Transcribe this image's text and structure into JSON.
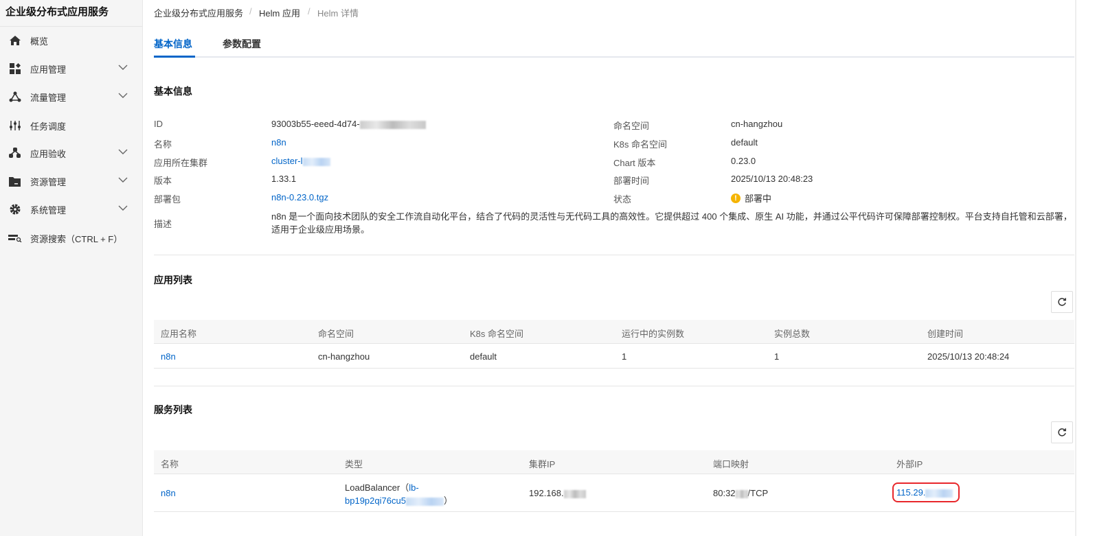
{
  "sidebar": {
    "title": "企业级分布式应用服务",
    "items": [
      {
        "label": "概览",
        "icon": "home-icon",
        "expandable": false
      },
      {
        "label": "应用管理",
        "icon": "apps-icon",
        "expandable": true
      },
      {
        "label": "流量管理",
        "icon": "network-icon",
        "expandable": true
      },
      {
        "label": "任务调度",
        "icon": "sliders-icon",
        "expandable": false
      },
      {
        "label": "应用验收",
        "icon": "cluster-icon",
        "expandable": true
      },
      {
        "label": "资源管理",
        "icon": "folder-icon",
        "expandable": true
      },
      {
        "label": "系统管理",
        "icon": "gear-icon",
        "expandable": true
      },
      {
        "label": "资源搜索（CTRL + F）",
        "icon": "search-resource-icon",
        "expandable": false
      }
    ]
  },
  "breadcrumb": [
    "企业级分布式应用服务",
    "Helm 应用",
    "Helm 详情"
  ],
  "tabs": [
    {
      "label": "基本信息",
      "active": true
    },
    {
      "label": "参数配置",
      "active": false
    }
  ],
  "basic": {
    "title": "基本信息",
    "left": [
      {
        "label": "ID",
        "value": "93003b55-eeed-4d74-"
      },
      {
        "label": "名称",
        "value": "n8n"
      },
      {
        "label": "应用所在集群",
        "value": "cluster-l"
      },
      {
        "label": "版本",
        "value": "1.33.1"
      },
      {
        "label": "部署包",
        "value": "n8n-0.23.0.tgz"
      }
    ],
    "right": [
      {
        "label": "命名空间",
        "value": "cn-hangzhou"
      },
      {
        "label": "K8s 命名空间",
        "value": "default"
      },
      {
        "label": "Chart 版本",
        "value": "0.23.0"
      },
      {
        "label": "部署时间",
        "value": "2025/10/13 20:48:23"
      },
      {
        "label": "状态",
        "value": "部署中"
      }
    ],
    "desc_label": "描述",
    "desc": "n8n 是一个面向技术团队的安全工作流自动化平台，结合了代码的灵活性与无代码工具的高效性。它提供超过 400 个集成、原生 AI 功能，并通过公平代码许可保障部署控制权。平台支持自托管和云部署，适用于企业级应用场景。"
  },
  "apps": {
    "title": "应用列表",
    "columns": [
      "应用名称",
      "命名空间",
      "K8s 命名空间",
      "运行中的实例数",
      "实例总数",
      "创建时间"
    ],
    "rows": [
      [
        "n8n",
        "cn-hangzhou",
        "default",
        "1",
        "1",
        "2025/10/13 20:48:24"
      ]
    ]
  },
  "services": {
    "title": "服务列表",
    "columns": [
      "名称",
      "类型",
      "集群IP",
      "端口映射",
      "外部IP"
    ],
    "rows": [
      {
        "name": "n8n",
        "type_prefix": "LoadBalancer（",
        "type_link1": "lb-",
        "type_link2": "bp19p2qi76cu5",
        "type_suffix": "）",
        "cluster_ip": "192.168.",
        "port_a": "80:32",
        "port_b": "/TCP",
        "external_ip": "115.29."
      }
    ]
  },
  "colors": {
    "accent": "#0064c8",
    "warning": "#f5b400",
    "highlight": "#e8262a"
  }
}
